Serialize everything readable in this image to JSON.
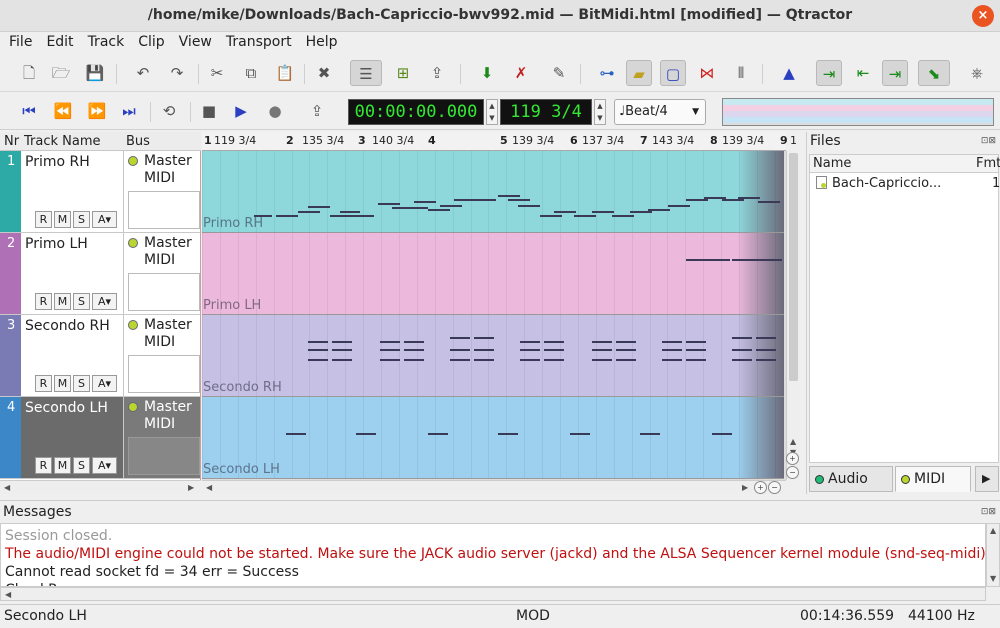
{
  "window": {
    "title": "/home/mike/Downloads/Bach-Capriccio-bwv992.mid — BitMidi.html [modified] — Qtractor"
  },
  "menu": [
    "File",
    "Edit",
    "Track",
    "Clip",
    "View",
    "Transport",
    "Help"
  ],
  "transport": {
    "time": "00:00:00.000",
    "bbt": "119 3/4",
    "snap": "Beat/4"
  },
  "tracklist": {
    "headers": {
      "nr": "Nr",
      "name": "Track Name",
      "bus": "Bus"
    },
    "tracks": [
      {
        "nr": "1",
        "name": "Primo RH",
        "bus": "Master MIDI",
        "color": "#2eaaa6",
        "lane_color": "#8ed8dc",
        "selected": false
      },
      {
        "nr": "2",
        "name": "Primo LH",
        "bus": "Master MIDI",
        "color": "#b070b6",
        "lane_color": "#ecb8dc",
        "selected": false
      },
      {
        "nr": "3",
        "name": "Secondo RH",
        "bus": "Master MIDI",
        "color": "#7a7ab4",
        "lane_color": "#c6c0e4",
        "selected": false
      },
      {
        "nr": "4",
        "name": "Secondo LH",
        "bus": "Master MIDI",
        "color": "#3b87c8",
        "lane_color": "#9cd0ee",
        "selected": true
      }
    ],
    "buttons": {
      "r": "R",
      "m": "M",
      "s": "S",
      "a": "A"
    }
  },
  "ruler": [
    {
      "label": "1",
      "bar": true
    },
    {
      "label": "119 3/4",
      "bar": false
    },
    {
      "label": "2",
      "bar": true
    },
    {
      "label": "135 3/4",
      "bar": false
    },
    {
      "label": "3",
      "bar": true
    },
    {
      "label": "140 3/4",
      "bar": false
    },
    {
      "label": "4",
      "bar": true
    },
    {
      "label": "5",
      "bar": true
    },
    {
      "label": "139 3/4",
      "bar": false
    },
    {
      "label": "6",
      "bar": true
    },
    {
      "label": "137 3/4",
      "bar": false
    },
    {
      "label": "7",
      "bar": true
    },
    {
      "label": "143 3/4",
      "bar": false
    },
    {
      "label": "8",
      "bar": true
    },
    {
      "label": "139 3/4",
      "bar": false
    },
    {
      "label": "9",
      "bar": true
    },
    {
      "label": "1",
      "bar": false
    }
  ],
  "files": {
    "title": "Files",
    "headers": {
      "name": "Name",
      "fmt": "Fmt"
    },
    "items": [
      {
        "name": "Bach-Capriccio...",
        "fmt": "1"
      }
    ],
    "tabs": [
      {
        "label": "Audio"
      },
      {
        "label": "MIDI"
      }
    ]
  },
  "messages": {
    "title": "Messages",
    "lines": [
      {
        "text": "Session closed.",
        "kind": "gray"
      },
      {
        "text": "The audio/MIDI engine could not be started. Make sure the JACK audio server (jackd) and the ALSA Sequencer kernel module (snd-seq-midi) ar",
        "kind": "red"
      },
      {
        "text": "Cannot read socket fd = 34 err = Success",
        "kind": "normal"
      },
      {
        "text": "CheckRes error",
        "kind": "normal"
      }
    ]
  },
  "status": {
    "track": "Secondo LH",
    "mod": "MOD",
    "time": "00:14:36.559",
    "rate": "44100 Hz"
  }
}
